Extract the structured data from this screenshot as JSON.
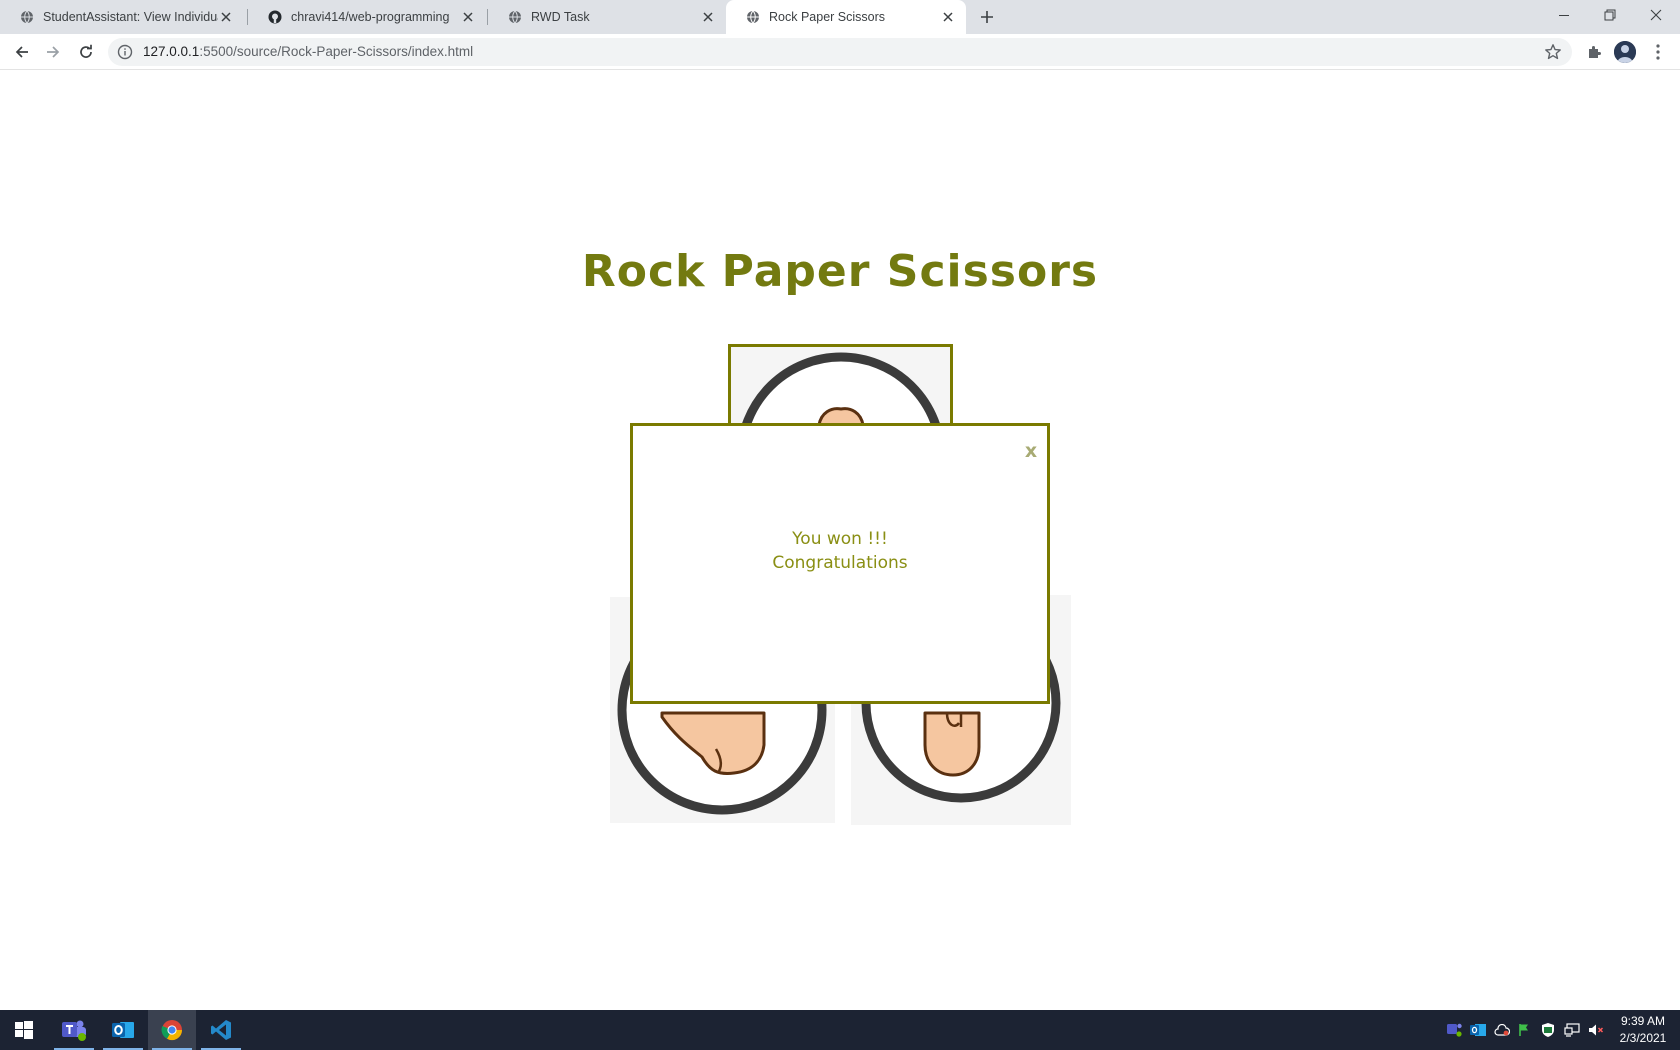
{
  "browser": {
    "tabs": [
      {
        "title": "StudentAssistant: View Individual",
        "icon": "globe-icon",
        "active": false
      },
      {
        "title": "chravi414/web-programming",
        "icon": "github-icon",
        "active": false
      },
      {
        "title": "RWD Task",
        "icon": "globe-icon",
        "active": false
      },
      {
        "title": "Rock Paper Scissors",
        "icon": "globe-icon",
        "active": true
      }
    ],
    "address": {
      "host": "127.0.0.1",
      "path": ":5500/source/Rock-Paper-Scissors/index.html"
    }
  },
  "page": {
    "title": "Rock Paper Scissors",
    "choices": [
      {
        "name": "rock",
        "selected": true
      },
      {
        "name": "paper",
        "selected": false
      },
      {
        "name": "scissors",
        "selected": false
      }
    ]
  },
  "modal": {
    "close_label": "x",
    "message_line1": "You won !!!",
    "message_line2": "Congratulations"
  },
  "taskbar": {
    "apps": [
      "start-button",
      "teams-icon",
      "outlook-icon",
      "chrome-icon",
      "vscode-icon"
    ],
    "time": "9:39 AM",
    "date": "2/3/2021"
  },
  "colors": {
    "accent": "#737a10",
    "border": "#7a7a00",
    "tab_strip": "#dee1e6",
    "taskbar": "#1c2333",
    "skin": "#f5c6a0"
  }
}
